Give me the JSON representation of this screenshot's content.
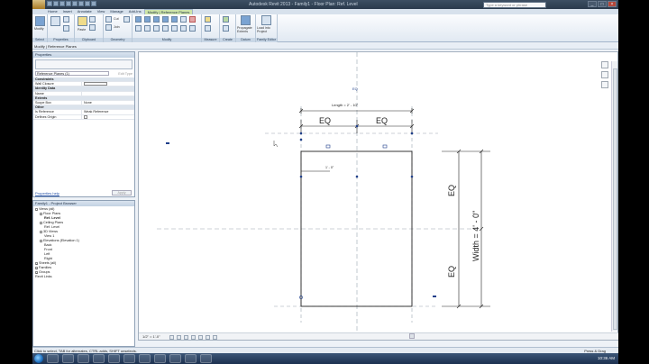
{
  "window": {
    "title": "Autodesk Revit 2013 - Family1 - Floor Plan: Ref. Level",
    "search_placeholder": "Type a keyword or phrase",
    "controls": [
      "_",
      "□",
      "×"
    ]
  },
  "ribbon_tabs": [
    {
      "label": "Home"
    },
    {
      "label": "Insert"
    },
    {
      "label": "Annotate"
    },
    {
      "label": "View"
    },
    {
      "label": "Manage"
    },
    {
      "label": "Add-Ins"
    },
    {
      "label": "Modify | Reference Planes",
      "contextual": true
    }
  ],
  "ribbon_panels": {
    "select": "Select",
    "properties": "Properties",
    "clipboard": "Clipboard",
    "geometry": "Geometry",
    "modify": "Modify",
    "measure": "Measure",
    "create": "Create",
    "datum": "Datum",
    "family_editor": "Family Editor"
  },
  "ribbon_buttons": {
    "modify": "Modify",
    "paste": "Paste",
    "cut": "Cut",
    "join": "Join",
    "propagate": "Propagate Extents",
    "load_into_project": "Load into Project"
  },
  "context_bar": "Modify | Reference Planes",
  "properties": {
    "header": "Properties",
    "type_selector": "Reference Planes (1)",
    "edit_type": "Edit Type",
    "rows": [
      {
        "group": "Constraints"
      },
      {
        "key": "Wall Closure",
        "value": ""
      },
      {
        "group": "Identity Data"
      },
      {
        "key": "Name",
        "value": ""
      },
      {
        "group": "Extents"
      },
      {
        "key": "Scope Box",
        "value": "None"
      },
      {
        "group": "Other"
      },
      {
        "key": "Is Reference",
        "value": "Weak Reference"
      },
      {
        "key": "Defines Origin",
        "value": ""
      }
    ],
    "help_link": "Properties help",
    "apply": "Apply"
  },
  "project_browser": {
    "header": "Family1 - Project Browser",
    "nodes": [
      {
        "label": "Views (all)",
        "indent": 0,
        "toggle": "-"
      },
      {
        "label": "Floor Plans",
        "indent": 1,
        "toggle": "-"
      },
      {
        "label": "Ref. Level",
        "indent": 2,
        "bold": true
      },
      {
        "label": "Ceiling Plans",
        "indent": 1,
        "toggle": "-"
      },
      {
        "label": "Ref. Level",
        "indent": 2
      },
      {
        "label": "3D Views",
        "indent": 1,
        "toggle": "-"
      },
      {
        "label": "View 1",
        "indent": 2
      },
      {
        "label": "Elevations (Elevation 1)",
        "indent": 1,
        "toggle": "-"
      },
      {
        "label": "Back",
        "indent": 2
      },
      {
        "label": "Front",
        "indent": 2
      },
      {
        "label": "Left",
        "indent": 2
      },
      {
        "label": "Right",
        "indent": 2
      },
      {
        "label": "Sheets (all)",
        "indent": 0,
        "toggle": "+"
      },
      {
        "label": "Families",
        "indent": 0,
        "toggle": "+"
      },
      {
        "label": "Groups",
        "indent": 0,
        "toggle": "+"
      },
      {
        "label": "Revit Links",
        "indent": 0
      }
    ]
  },
  "drawing": {
    "label_length": "Length = 2' - 10\"",
    "eq": "EQ",
    "label_width": "Width = 4' - 0\"",
    "small_dim": "1' - 0\"",
    "scale": "1/2\" = 1'-0\""
  },
  "status": {
    "text": "Click to select, TAB for alternates, CTRL adds, SHIFT unselects.",
    "press_drag": "Press & Drag",
    "clock": "10:36 AM"
  }
}
